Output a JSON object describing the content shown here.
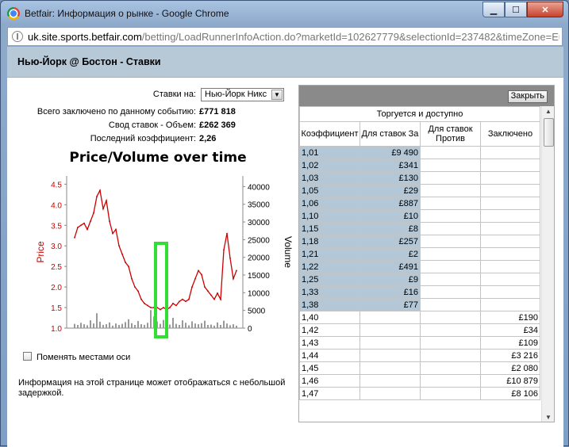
{
  "window": {
    "title": "Betfair: Информация о рынке - Google Chrome"
  },
  "address": {
    "host": "uk.site.sports.betfair.com",
    "path": "/betting/LoadRunnerInfoAction.do?marketId=102627779&selectionId=237482&timeZone=Europe/Mc"
  },
  "header": {
    "title": "Нью-Йорк @ Бостон - Ставки"
  },
  "info": {
    "bets_on_label": "Ставки на:",
    "bets_on_value": "Нью-Йорк Никс",
    "total_label": "Всего заключено по данному событию:",
    "total_value": "£771 818",
    "volume_label": "Свод ставок - Объем:",
    "volume_value": "£262 369",
    "last_label": "Последний коэффициент:",
    "last_value": "2,26"
  },
  "chart_data": {
    "type": "line",
    "title": "Price/Volume over time",
    "ylabel": "Price",
    "y2label": "Volume",
    "ylim": [
      1.0,
      4.7
    ],
    "y2lim": [
      0,
      43000
    ],
    "yticks": [
      "4.5",
      "4.0",
      "3.5",
      "3.0",
      "2.5",
      "2.0",
      "1.5",
      "1.0"
    ],
    "y2ticks": [
      "40000",
      "35000",
      "30000",
      "25000",
      "20000",
      "15000",
      "10000",
      "5000",
      "0"
    ],
    "series": [
      {
        "name": "Price",
        "color": "#cc0000",
        "values": [
          3.2,
          3.45,
          3.5,
          3.55,
          3.4,
          3.6,
          3.8,
          4.2,
          4.35,
          3.9,
          4.1,
          3.6,
          3.3,
          3.4,
          3.0,
          2.8,
          2.6,
          2.5,
          2.2,
          2.0,
          1.9,
          1.7,
          1.6,
          1.55,
          1.5,
          1.5,
          1.5,
          1.45,
          1.5,
          1.45,
          1.5,
          1.6,
          1.55,
          1.65,
          1.7,
          1.65,
          1.7,
          2.0,
          2.2,
          2.4,
          2.3,
          2.0,
          1.9,
          1.8,
          1.7,
          1.85,
          1.7,
          2.9,
          3.3,
          2.7,
          2.2,
          2.4
        ]
      },
      {
        "name": "Volume",
        "color": "#999999",
        "values": [
          1200,
          900,
          1500,
          1100,
          800,
          2200,
          1300,
          4200,
          1800,
          900,
          1100,
          1600,
          700,
          1300,
          900,
          1200,
          1700,
          2500,
          1400,
          900,
          2000,
          1100,
          900,
          1500,
          5100,
          3300,
          1900,
          1200,
          2300,
          1700,
          1000,
          2900,
          1200,
          900,
          2200,
          1500,
          800,
          1900,
          1300,
          1100,
          1400,
          2100,
          900,
          1000,
          700,
          1600,
          900,
          2100,
          1300,
          800,
          1100,
          700
        ]
      }
    ],
    "highlight_box": {
      "color": "#33dd33"
    }
  },
  "swap_axes_label": "Поменять местами оси",
  "note": "Информация на этой странице может отображаться с небольшой задержкой.",
  "odds_panel": {
    "close_label": "Закрыть",
    "group_header": "Торгуется и доступно",
    "columns": [
      "Коэффициент",
      "Для ставок За",
      "Для ставок Против",
      "Заключено"
    ],
    "rows": [
      {
        "odds": "1,01",
        "back": "£9 490",
        "lay": "",
        "matched": "",
        "blue": true
      },
      {
        "odds": "1,02",
        "back": "£341",
        "lay": "",
        "matched": "",
        "blue": true
      },
      {
        "odds": "1,03",
        "back": "£130",
        "lay": "",
        "matched": "",
        "blue": true
      },
      {
        "odds": "1,05",
        "back": "£29",
        "lay": "",
        "matched": "",
        "blue": true
      },
      {
        "odds": "1,06",
        "back": "£887",
        "lay": "",
        "matched": "",
        "blue": true
      },
      {
        "odds": "1,10",
        "back": "£10",
        "lay": "",
        "matched": "",
        "blue": true
      },
      {
        "odds": "1,15",
        "back": "£8",
        "lay": "",
        "matched": "",
        "blue": true
      },
      {
        "odds": "1,18",
        "back": "£257",
        "lay": "",
        "matched": "",
        "blue": true
      },
      {
        "odds": "1,21",
        "back": "£2",
        "lay": "",
        "matched": "",
        "blue": true
      },
      {
        "odds": "1,22",
        "back": "£491",
        "lay": "",
        "matched": "",
        "blue": true
      },
      {
        "odds": "1,25",
        "back": "£9",
        "lay": "",
        "matched": "",
        "blue": true
      },
      {
        "odds": "1,33",
        "back": "£16",
        "lay": "",
        "matched": "",
        "blue": true
      },
      {
        "odds": "1,38",
        "back": "£77",
        "lay": "",
        "matched": "",
        "blue": true
      },
      {
        "odds": "1,40",
        "back": "",
        "lay": "",
        "matched": "£190",
        "blue": false
      },
      {
        "odds": "1,42",
        "back": "",
        "lay": "",
        "matched": "£34",
        "blue": false
      },
      {
        "odds": "1,43",
        "back": "",
        "lay": "",
        "matched": "£109",
        "blue": false
      },
      {
        "odds": "1,44",
        "back": "",
        "lay": "",
        "matched": "£3 216",
        "blue": false
      },
      {
        "odds": "1,45",
        "back": "",
        "lay": "",
        "matched": "£2 080",
        "blue": false
      },
      {
        "odds": "1,46",
        "back": "",
        "lay": "",
        "matched": "£10 879",
        "blue": false
      },
      {
        "odds": "1,47",
        "back": "",
        "lay": "",
        "matched": "£8 106",
        "blue": false
      }
    ]
  }
}
